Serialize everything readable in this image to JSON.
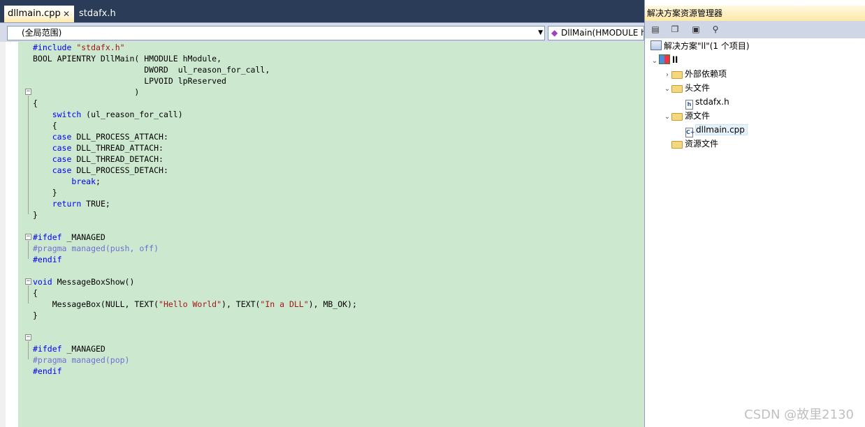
{
  "tabs": [
    {
      "label": "dllmain.cpp",
      "active": true,
      "close_glyph": "✕"
    },
    {
      "label": "stdafx.h",
      "active": false
    }
  ],
  "navbar": {
    "scope": "(全局范围)",
    "member": "DllMain(HMODULE h"
  },
  "code": [
    {
      "tokens": [
        {
          "t": "#include ",
          "c": "pp"
        },
        {
          "t": "\"stdafx.h\"",
          "c": "str"
        }
      ]
    },
    {
      "tokens": [
        {
          "t": "BOOL APIENTRY DllMain( HMODULE hModule,",
          "c": ""
        }
      ]
    },
    {
      "tokens": [
        {
          "t": "                       DWORD  ul_reason_for_call,",
          "c": ""
        }
      ]
    },
    {
      "tokens": [
        {
          "t": "                       LPVOID lpReserved",
          "c": ""
        }
      ]
    },
    {
      "tokens": [
        {
          "t": "                     )",
          "c": ""
        }
      ]
    },
    {
      "tokens": [
        {
          "t": "{",
          "c": ""
        }
      ]
    },
    {
      "tokens": [
        {
          "t": "    ",
          "c": ""
        },
        {
          "t": "switch",
          "c": "kw"
        },
        {
          "t": " (ul_reason_for_call)",
          "c": ""
        }
      ]
    },
    {
      "tokens": [
        {
          "t": "    {",
          "c": ""
        }
      ]
    },
    {
      "tokens": [
        {
          "t": "    ",
          "c": ""
        },
        {
          "t": "case",
          "c": "kw"
        },
        {
          "t": " DLL_PROCESS_ATTACH:",
          "c": ""
        }
      ]
    },
    {
      "tokens": [
        {
          "t": "    ",
          "c": ""
        },
        {
          "t": "case",
          "c": "kw"
        },
        {
          "t": " DLL_THREAD_ATTACH:",
          "c": ""
        }
      ]
    },
    {
      "tokens": [
        {
          "t": "    ",
          "c": ""
        },
        {
          "t": "case",
          "c": "kw"
        },
        {
          "t": " DLL_THREAD_DETACH:",
          "c": ""
        }
      ]
    },
    {
      "tokens": [
        {
          "t": "    ",
          "c": ""
        },
        {
          "t": "case",
          "c": "kw"
        },
        {
          "t": " DLL_PROCESS_DETACH:",
          "c": ""
        }
      ]
    },
    {
      "tokens": [
        {
          "t": "        ",
          "c": ""
        },
        {
          "t": "break",
          "c": "kw"
        },
        {
          "t": ";",
          "c": ""
        }
      ]
    },
    {
      "tokens": [
        {
          "t": "    }",
          "c": ""
        }
      ]
    },
    {
      "tokens": [
        {
          "t": "    ",
          "c": ""
        },
        {
          "t": "return",
          "c": "kw"
        },
        {
          "t": " TRUE;",
          "c": ""
        }
      ]
    },
    {
      "tokens": [
        {
          "t": "}",
          "c": ""
        }
      ]
    },
    {
      "tokens": []
    },
    {
      "tokens": [
        {
          "t": "#ifdef",
          "c": "pp"
        },
        {
          "t": " _MANAGED",
          "c": ""
        }
      ]
    },
    {
      "tokens": [
        {
          "t": "#pragma managed(push, off)",
          "c": "gray"
        }
      ]
    },
    {
      "tokens": [
        {
          "t": "#endif",
          "c": "pp"
        }
      ]
    },
    {
      "tokens": []
    },
    {
      "tokens": [
        {
          "t": "void",
          "c": "kw"
        },
        {
          "t": " MessageBoxShow()",
          "c": ""
        }
      ]
    },
    {
      "tokens": [
        {
          "t": "{",
          "c": ""
        }
      ]
    },
    {
      "tokens": [
        {
          "t": "    MessageBox(NULL, TEXT(",
          "c": ""
        },
        {
          "t": "\"Hello World\"",
          "c": "str"
        },
        {
          "t": "), TEXT(",
          "c": ""
        },
        {
          "t": "\"In a DLL\"",
          "c": "str"
        },
        {
          "t": "), MB_OK);",
          "c": ""
        }
      ]
    },
    {
      "tokens": [
        {
          "t": "}",
          "c": ""
        }
      ]
    },
    {
      "tokens": []
    },
    {
      "tokens": []
    },
    {
      "tokens": [
        {
          "t": "#ifdef",
          "c": "pp"
        },
        {
          "t": " _MANAGED",
          "c": ""
        }
      ]
    },
    {
      "tokens": [
        {
          "t": "#pragma managed(pop)",
          "c": "gray"
        }
      ]
    },
    {
      "tokens": [
        {
          "t": "#endif",
          "c": "pp"
        }
      ]
    }
  ],
  "explorer": {
    "title": "解决方案资源管理器",
    "toolbar": [
      {
        "name": "properties-icon",
        "glyph": "▤"
      },
      {
        "name": "show-all-files-icon",
        "glyph": "❐"
      },
      {
        "name": "refresh-icon",
        "glyph": "▣"
      },
      {
        "name": "view-class-diagram-icon",
        "glyph": "⚲"
      }
    ],
    "tree": [
      {
        "label": "解决方案\"ll\"(1 个项目)",
        "level": 0,
        "twisty": "",
        "icon": "solution-icon"
      },
      {
        "label": "ll",
        "level": 0,
        "twisty": "⌄",
        "icon": "project-icon",
        "bold": true
      },
      {
        "label": "外部依赖项",
        "level": 1,
        "twisty": "›",
        "icon": "folder-icon"
      },
      {
        "label": "头文件",
        "level": 1,
        "twisty": "⌄",
        "icon": "folder-open-icon"
      },
      {
        "label": "stdafx.h",
        "level": 2,
        "twisty": "",
        "icon": "header-file-icon",
        "glyph": "h"
      },
      {
        "label": "源文件",
        "level": 1,
        "twisty": "⌄",
        "icon": "folder-open-icon"
      },
      {
        "label": "dllmain.cpp",
        "level": 2,
        "twisty": "",
        "icon": "cpp-file-icon",
        "glyph": "C+",
        "selected": true
      },
      {
        "label": "资源文件",
        "level": 1,
        "twisty": "",
        "icon": "folder-icon"
      }
    ]
  },
  "watermark": "CSDN @故里2130"
}
